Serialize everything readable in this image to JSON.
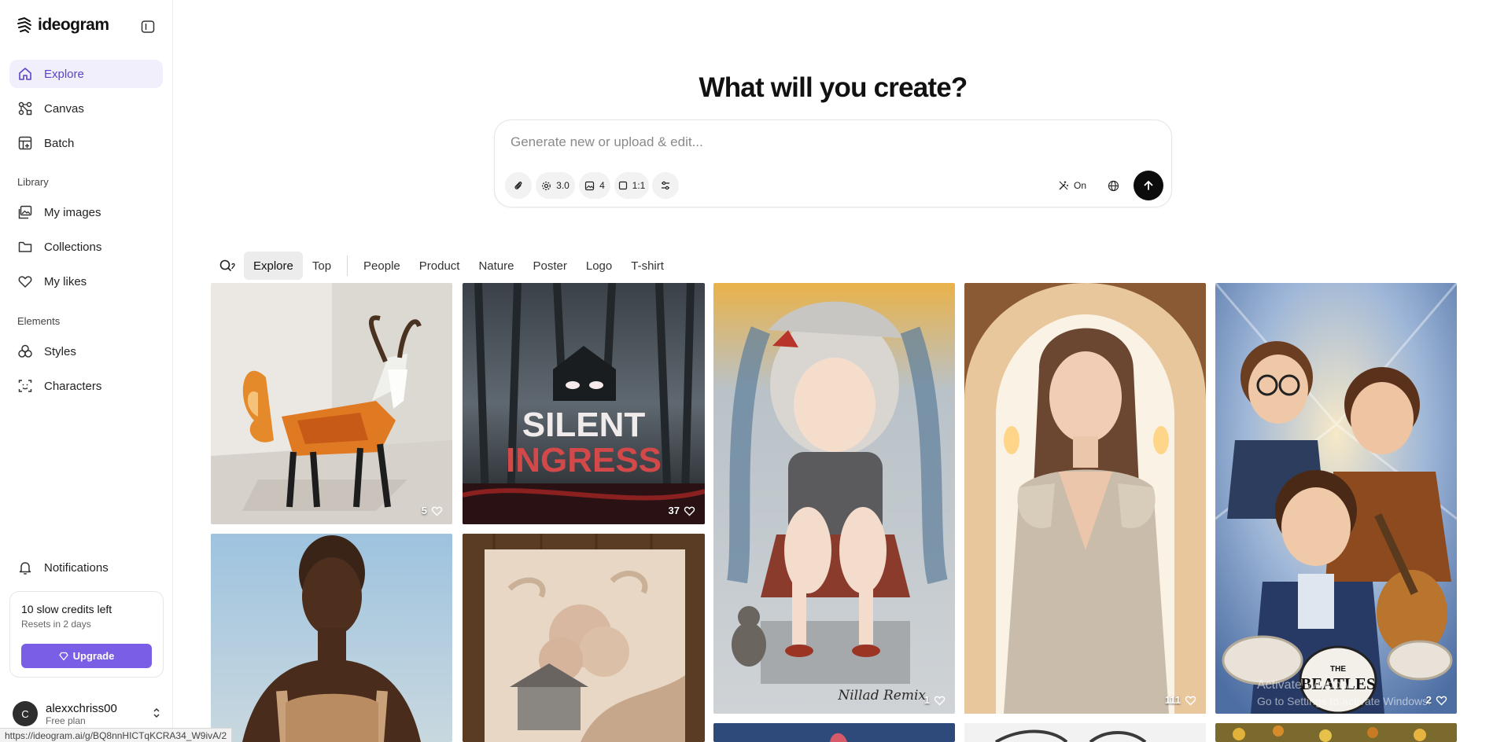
{
  "brand": {
    "name": "ideogram"
  },
  "nav": {
    "explore": "Explore",
    "canvas": "Canvas",
    "batch": "Batch",
    "library_label": "Library",
    "my_images": "My images",
    "collections": "Collections",
    "my_likes": "My likes",
    "elements_label": "Elements",
    "styles": "Styles",
    "characters": "Characters",
    "notifications": "Notifications"
  },
  "credits": {
    "title": "10 slow credits left",
    "reset": "Resets in 2 days",
    "upgrade_label": "Upgrade"
  },
  "user": {
    "initial": "C",
    "name": "alexxchriss00",
    "plan": "Free plan"
  },
  "status_url": "https://ideogram.ai/g/BQ8nnHICTqKCRA34_W9ivA/2",
  "hero": {
    "title": "What will you create?"
  },
  "prompt": {
    "placeholder": "Generate new or upload & edit...",
    "model_version": "3.0",
    "image_count": "4",
    "aspect_ratio": "1:1",
    "magic_prompt": "On"
  },
  "filters": {
    "tabs": [
      "Explore",
      "Top",
      "People",
      "Product",
      "Nature",
      "Poster",
      "Logo",
      "T-shirt"
    ],
    "active": "Explore"
  },
  "gallery": {
    "items": [
      {
        "subject": "geometric goat illustration",
        "likes": "5"
      },
      {
        "subject": "Silent Ingress horror poster",
        "title_line1": "SILENT",
        "title_line2": "INGRESS",
        "likes": "37"
      },
      {
        "subject": "illustrated girl with monkey",
        "signature": "Nillad Remix",
        "likes": "1"
      },
      {
        "subject": "woman in satin dress portrait",
        "likes": "111"
      },
      {
        "subject": "Beatles cartoon band",
        "drum_text_1": "THE",
        "drum_text_2": "BEATLES",
        "likes": "2"
      },
      {
        "subject": "woman portrait at sunset",
        "likes": ""
      },
      {
        "subject": "carved relief artwork",
        "likes": ""
      }
    ]
  },
  "os_watermark": {
    "line1": "Activate Windows",
    "line2": "Go to Settings to activate Windows."
  },
  "colors": {
    "accent": "#7b5ee6",
    "active_nav_bg": "#f1effb",
    "active_nav_text": "#5b44c9",
    "send_button": "#0c0c0c"
  }
}
